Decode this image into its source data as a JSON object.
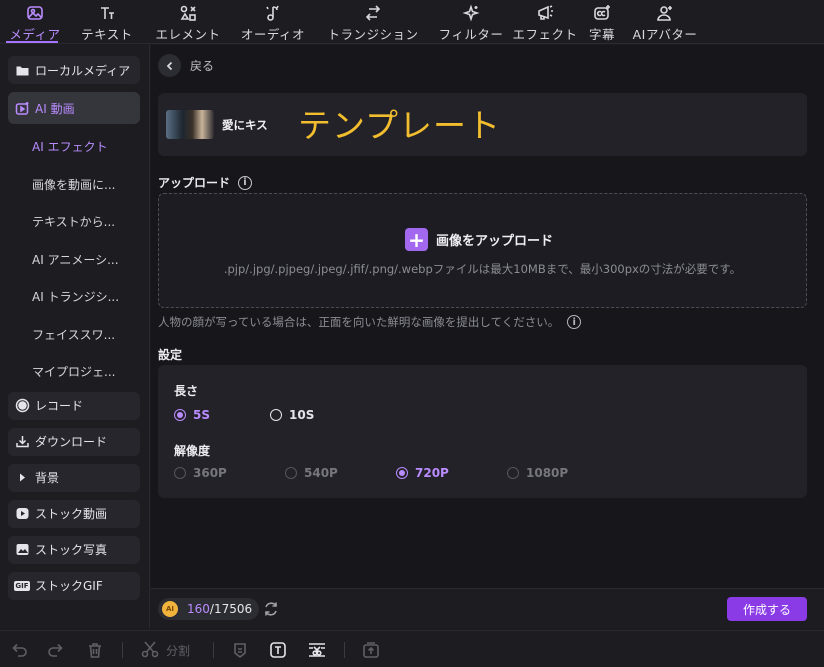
{
  "toolbar": {
    "items": [
      {
        "label": "メディア",
        "icon": "media-icon"
      },
      {
        "label": "テキスト",
        "icon": "text-icon"
      },
      {
        "label": "エレメント",
        "icon": "elements-icon"
      },
      {
        "label": "オーディオ",
        "icon": "audio-icon"
      },
      {
        "label": "トランジション",
        "icon": "transition-icon"
      },
      {
        "label": "フィルター",
        "icon": "filter-icon"
      },
      {
        "label": "エフェクト",
        "icon": "effects-icon"
      },
      {
        "label": "字幕",
        "icon": "captions-icon"
      },
      {
        "label": "AIアバター",
        "icon": "ai-avatar-icon"
      }
    ],
    "active_index": 0
  },
  "sidebar": {
    "local_media": "ローカルメディア",
    "ai_video": "AI 動画",
    "ai_sub": [
      "AI エフェクト",
      "画像を動画に...",
      "テキストから...",
      "AI アニメーシ...",
      "AI トランジシ...",
      "フェイススワ...",
      "マイプロジェ..."
    ],
    "record": "レコード",
    "download": "ダウンロード",
    "background": "背景",
    "stock_video": "ストック動画",
    "stock_photo": "ストック写真",
    "stock_gif": "ストックGIF",
    "gif_icon_text": "GIF"
  },
  "main": {
    "back_label": "戻る",
    "template": {
      "name": "愛にキス",
      "title": "テンプレート"
    },
    "upload": {
      "section_title": "アップロード",
      "button_label": "画像をアップロード",
      "hint": ".pjp/.jpg/.pjpeg/.jpeg/.jfif/.png/.webpファイルは最大10MBまで、最小300pxの寸法が必要です。",
      "note": "人物の顔が写っている場合は、正面を向いた鮮明な画像を提出してください。"
    },
    "settings": {
      "section_title": "設定",
      "duration_label": "長さ",
      "duration_options": [
        "5S",
        "10S"
      ],
      "duration_selected": "5S",
      "resolution_label": "解像度",
      "resolution_options": [
        "360P",
        "540P",
        "720P",
        "1080P"
      ],
      "resolution_selected": "720P"
    }
  },
  "footer": {
    "coin_text": "AI",
    "credits_used": "160",
    "credits_total": "/17506",
    "create_label": "作成する"
  },
  "bottombar": {
    "split_label": "分割"
  },
  "colors": {
    "accent": "#b98cff",
    "button": "#8a3be6",
    "template_title": "#f2bd2e"
  }
}
